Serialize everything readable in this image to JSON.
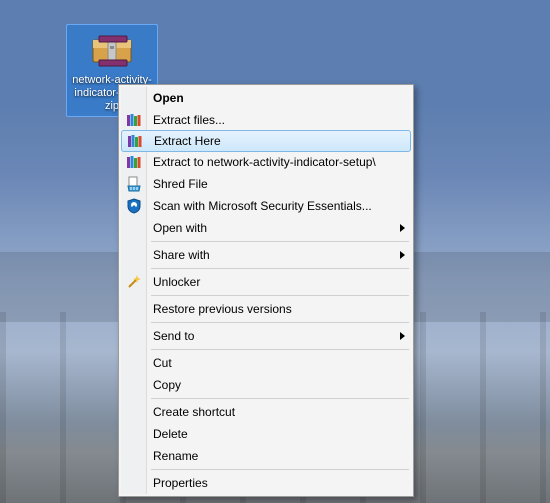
{
  "desktop": {
    "file_label": "network-activity-indicator-setup.zip"
  },
  "context_menu": {
    "items": {
      "open": {
        "label": "Open"
      },
      "extract_files": {
        "label": "Extract files..."
      },
      "extract_here": {
        "label": "Extract Here"
      },
      "extract_to": {
        "label": "Extract to network-activity-indicator-setup\\"
      },
      "shred": {
        "label": "Shred File"
      },
      "scan": {
        "label": "Scan with Microsoft Security Essentials..."
      },
      "open_with": {
        "label": "Open with"
      },
      "share_with": {
        "label": "Share with"
      },
      "unlocker": {
        "label": "Unlocker"
      },
      "restore": {
        "label": "Restore previous versions"
      },
      "send_to": {
        "label": "Send to"
      },
      "cut": {
        "label": "Cut"
      },
      "copy": {
        "label": "Copy"
      },
      "shortcut": {
        "label": "Create shortcut"
      },
      "delete": {
        "label": "Delete"
      },
      "rename": {
        "label": "Rename"
      },
      "properties": {
        "label": "Properties"
      }
    },
    "highlighted_key": "extract_here"
  },
  "icons": {
    "winrar_archive": "winrar-archive-icon",
    "winrar_books": "winrar-books-icon",
    "shred": "file-shred-icon",
    "mse_shield": "mse-shield-icon",
    "unlocker_wand": "unlocker-wand-icon"
  }
}
